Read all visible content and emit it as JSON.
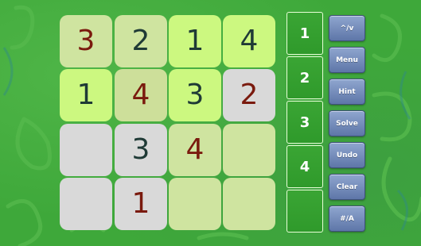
{
  "board": {
    "rows": [
      [
        {
          "value": "3",
          "tone": "red",
          "bg": "olive"
        },
        {
          "value": "2",
          "tone": "dark",
          "bg": "olive"
        },
        {
          "value": "1",
          "tone": "dark",
          "bg": "lime"
        },
        {
          "value": "4",
          "tone": "dark",
          "bg": "lime"
        }
      ],
      [
        {
          "value": "1",
          "tone": "dark",
          "bg": "lime"
        },
        {
          "value": "4",
          "tone": "red",
          "bg": "sage"
        },
        {
          "value": "3",
          "tone": "dark",
          "bg": "lime"
        },
        {
          "value": "2",
          "tone": "red",
          "bg": "grey"
        }
      ],
      [
        {
          "value": "",
          "tone": "dark",
          "bg": "grey"
        },
        {
          "value": "3",
          "tone": "dark",
          "bg": "grey"
        },
        {
          "value": "4",
          "tone": "red",
          "bg": "olive"
        },
        {
          "value": "",
          "tone": "dark",
          "bg": "olive"
        }
      ],
      [
        {
          "value": "",
          "tone": "dark",
          "bg": "grey"
        },
        {
          "value": "1",
          "tone": "red",
          "bg": "grey"
        },
        {
          "value": "",
          "tone": "dark",
          "bg": "olive"
        },
        {
          "value": "",
          "tone": "dark",
          "bg": "olive"
        }
      ]
    ]
  },
  "number_picker": [
    "1",
    "2",
    "3",
    "4",
    ""
  ],
  "controls": {
    "toggle_label": "^/v",
    "menu_label": "Menu",
    "hint_label": "Hint",
    "solve_label": "Solve",
    "undo_label": "Undo",
    "clear_label": "Clear",
    "mode_label": "#/A"
  },
  "colors": {
    "background": "#3ea83a",
    "given_digit": "#1f3a36",
    "user_digit": "#7a1a0e",
    "button": "#6d85b6"
  }
}
